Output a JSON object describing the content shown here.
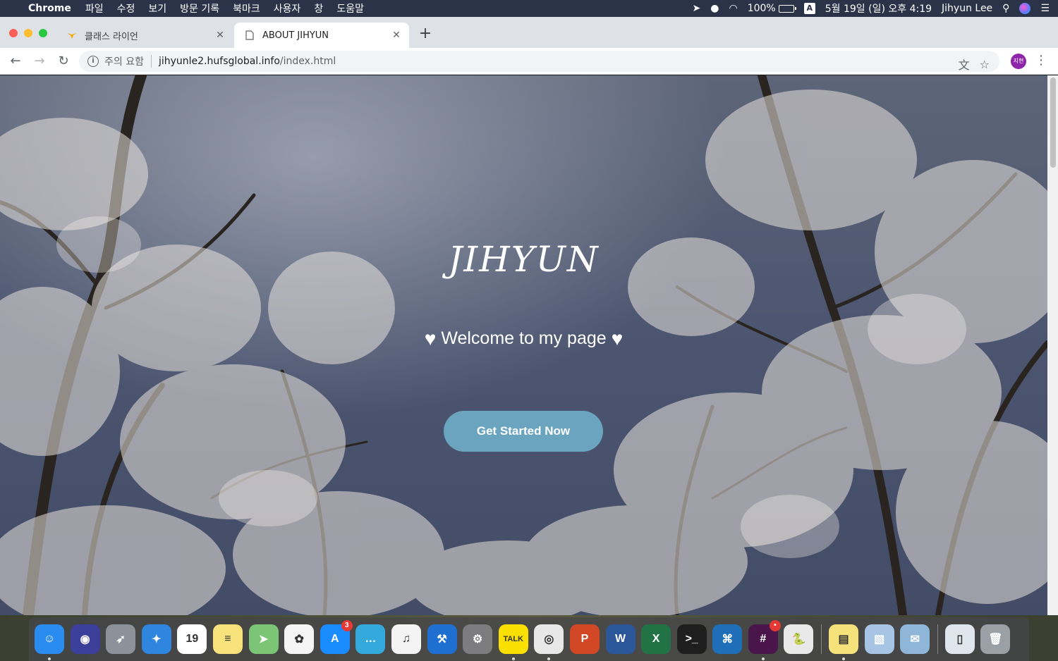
{
  "menubar": {
    "app_name": "Chrome",
    "menus": [
      "파일",
      "수정",
      "보기",
      "방문 기록",
      "북마크",
      "사용자",
      "창",
      "도움말"
    ],
    "battery": "100%",
    "input_source": "A",
    "datetime": "5월 19일 (일) 오후 4:19",
    "user": "Jihyun Lee"
  },
  "tabs": [
    {
      "title": "클래스 라이언",
      "active": false
    },
    {
      "title": "ABOUT JIHYUN",
      "active": true
    }
  ],
  "toolbar": {
    "security_label": "주의 요함",
    "url_host": "jihyunle2.hufsglobal.info",
    "url_path": "/index.html",
    "avatar_label": "지현"
  },
  "hero": {
    "title": "JIHYUN",
    "subtitle": "Welcome to my page",
    "cta_label": "Get Started Now"
  },
  "dock": {
    "apps": [
      {
        "name": "finder",
        "color": "#2b8cf0",
        "glyph": "☺",
        "running": true
      },
      {
        "name": "siri",
        "color": "#3b3f9a",
        "glyph": "◉",
        "running": false
      },
      {
        "name": "launchpad",
        "color": "#8d929a",
        "glyph": "➶",
        "running": false
      },
      {
        "name": "safari",
        "color": "#2e86de",
        "glyph": "✦",
        "running": false
      },
      {
        "name": "calendar",
        "color": "#ffffff",
        "glyph": "19",
        "running": false
      },
      {
        "name": "notes",
        "color": "#f7e27b",
        "glyph": "≡",
        "running": false
      },
      {
        "name": "maps",
        "color": "#7cc576",
        "glyph": "➤",
        "running": false
      },
      {
        "name": "photos",
        "color": "#f5f5f5",
        "glyph": "✿",
        "running": false
      },
      {
        "name": "app-store",
        "color": "#1a8cff",
        "glyph": "A",
        "badge": "3",
        "running": false
      },
      {
        "name": "messages",
        "color": "#34aadc",
        "glyph": "…",
        "running": false
      },
      {
        "name": "itunes",
        "color": "#f4f4f4",
        "glyph": "♫",
        "running": false
      },
      {
        "name": "xcode",
        "color": "#1f6fd1",
        "glyph": "⚒",
        "running": false
      },
      {
        "name": "system-preferences",
        "color": "#7d7d80",
        "glyph": "⚙",
        "running": false
      },
      {
        "name": "kakaotalk",
        "color": "#f9e000",
        "glyph": "TALK",
        "running": true
      },
      {
        "name": "chrome",
        "color": "#e8e8e8",
        "glyph": "◎",
        "running": true
      },
      {
        "name": "powerpoint",
        "color": "#d24726",
        "glyph": "P",
        "running": false
      },
      {
        "name": "word",
        "color": "#2b579a",
        "glyph": "W",
        "running": false
      },
      {
        "name": "excel",
        "color": "#217346",
        "glyph": "X",
        "running": false
      },
      {
        "name": "terminal",
        "color": "#1e1e1e",
        "glyph": ">_",
        "running": false
      },
      {
        "name": "vscode",
        "color": "#1e6fb8",
        "glyph": "⌘",
        "running": false
      },
      {
        "name": "slack",
        "color": "#4a154b",
        "glyph": "#",
        "badge": "•",
        "running": true
      },
      {
        "name": "python",
        "color": "#e9e9e9",
        "glyph": "🐍",
        "running": false
      }
    ],
    "stack_apps": [
      {
        "name": "stickies",
        "color": "#f6e27a",
        "glyph": "▤",
        "running": true
      },
      {
        "name": "preview",
        "color": "#a7c4e4",
        "glyph": "▧",
        "running": false
      },
      {
        "name": "mail-stamp",
        "color": "#8fb6d8",
        "glyph": "✉",
        "running": false
      }
    ],
    "trash_apps": [
      {
        "name": "documents",
        "color": "#dfe6ee",
        "glyph": "▯",
        "running": false
      },
      {
        "name": "trash",
        "color": "#9aa0a6",
        "glyph": "🗑",
        "running": false
      }
    ]
  }
}
